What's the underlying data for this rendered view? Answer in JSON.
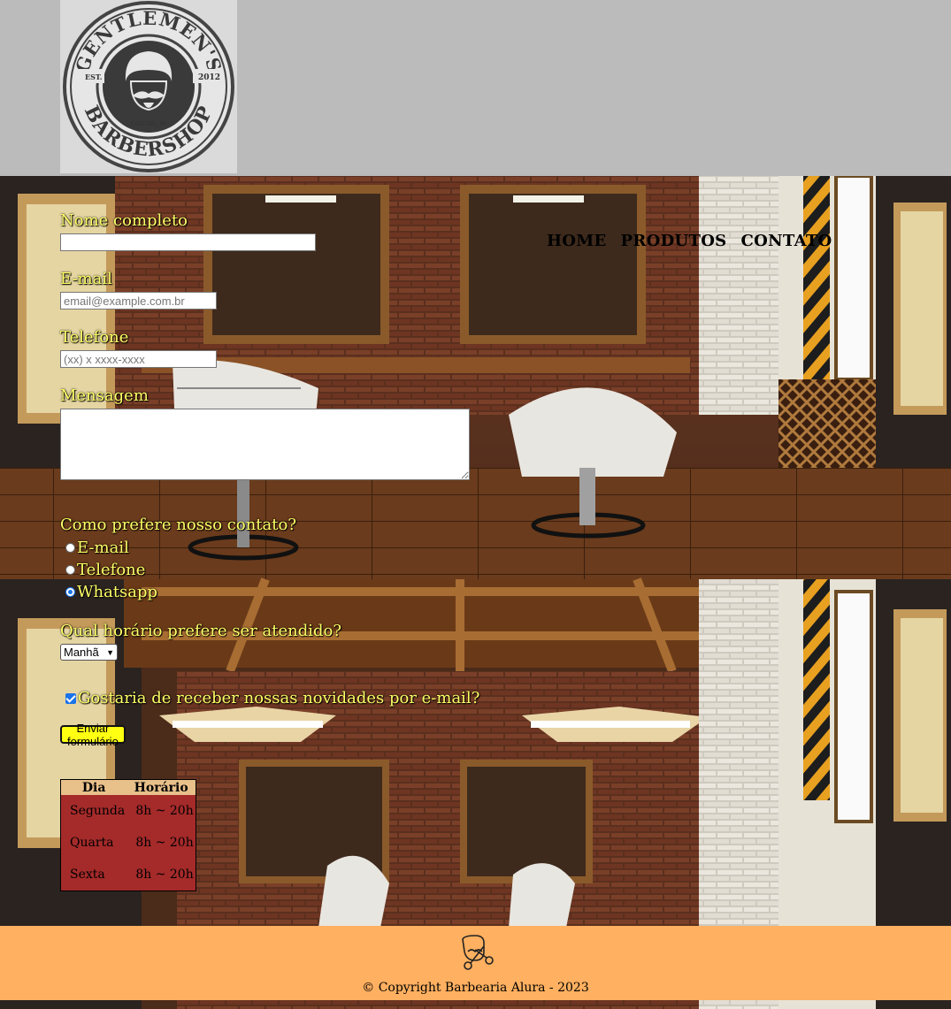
{
  "header": {
    "logo": {
      "top_text": "GENTLEMEN'S",
      "bottom_text": "BARBERSHOP",
      "left_badge": "EST.",
      "right_badge": "2012",
      "location": "EASTON, PA"
    }
  },
  "nav": {
    "items": [
      "HOME",
      "PRODUTOS",
      "CONTATO"
    ]
  },
  "form": {
    "name_label": "Nome completo",
    "name_value": "",
    "email_label": "E-mail",
    "email_placeholder": "email@example.com.br",
    "phone_label": "Telefone",
    "phone_placeholder": "(xx) x xxxx-xxxx",
    "message_label": "Mensagem",
    "message_value": "",
    "contact_question": "Como prefere nosso contato?",
    "contact_options": [
      {
        "label": "E-mail",
        "checked": false
      },
      {
        "label": "Telefone",
        "checked": false
      },
      {
        "label": "Whatsapp",
        "checked": true
      }
    ],
    "time_question": "Qual horário prefere ser atendido?",
    "time_selected": "Manhã",
    "newsletter_label": "Gostaria de receber nossas novidades por e-mail?",
    "newsletter_checked": true,
    "submit_label": "Enviar formulário"
  },
  "hours_table": {
    "headers": [
      "Dia",
      "Horário"
    ],
    "rows": [
      [
        "Segunda",
        "8h ~ 20h"
      ],
      [
        "Quarta",
        "8h ~ 20h"
      ],
      [
        "Sexta",
        "8h ~ 20h"
      ]
    ]
  },
  "footer": {
    "copyright": "© Copyright Barbearia Alura - 2023"
  },
  "colors": {
    "header_bg": "#bbbbbb",
    "label_text": "#ffff66",
    "submit_bg": "#ffff11",
    "table_header": "#e8c08a",
    "table_body": "#a52a2a",
    "footer_bg": "#ffb060",
    "radio_selected": "#1a73e8"
  }
}
